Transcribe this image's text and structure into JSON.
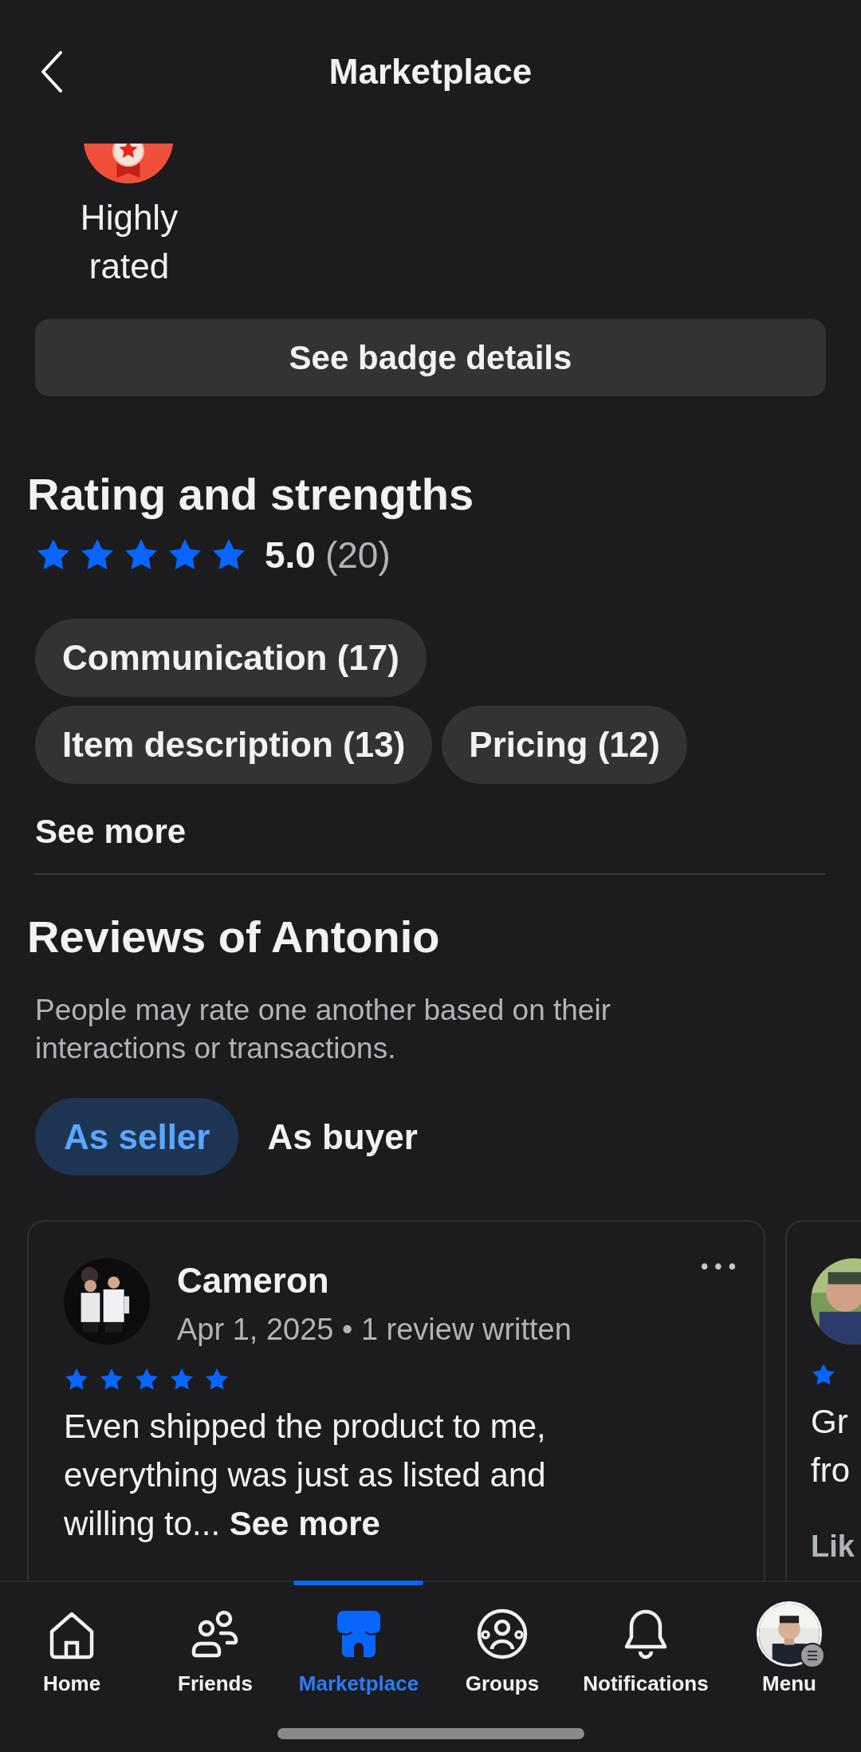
{
  "header": {
    "title": "Marketplace"
  },
  "badge": {
    "label": "Highly rated",
    "button": "See badge details"
  },
  "rating": {
    "heading": "Rating and strengths",
    "stars": 5,
    "score": "5.0",
    "count": "(20)"
  },
  "strengths": [
    {
      "label": "Communication (17)"
    },
    {
      "label": "Item description (13)"
    },
    {
      "label": "Pricing (12)"
    }
  ],
  "see_more": "See more",
  "reviews": {
    "heading": "Reviews of Antonio",
    "note": "People may rate one another based on their interactions or transactions.",
    "tabs": [
      {
        "label": "As seller",
        "selected": true
      },
      {
        "label": "As buyer",
        "selected": false
      }
    ],
    "cards": [
      {
        "name": "Cameron",
        "meta": "Apr 1, 2025 • 1 review written",
        "stars": 5,
        "text": "Even shipped the product to me, everything was just as listed and willing to...",
        "more": "See more",
        "more_menu": "•••"
      },
      {
        "text_lines": [
          "Gr",
          "fro"
        ],
        "footer": "Lik"
      }
    ]
  },
  "nav": [
    {
      "kind": "home",
      "label": "Home",
      "selected": false
    },
    {
      "kind": "friends",
      "label": "Friends",
      "selected": false
    },
    {
      "kind": "marketplace",
      "label": "Marketplace",
      "selected": true
    },
    {
      "kind": "groups",
      "label": "Groups",
      "selected": false
    },
    {
      "kind": "notifications",
      "label": "Notifications",
      "selected": false
    },
    {
      "kind": "menu",
      "label": "Menu",
      "selected": false
    }
  ]
}
